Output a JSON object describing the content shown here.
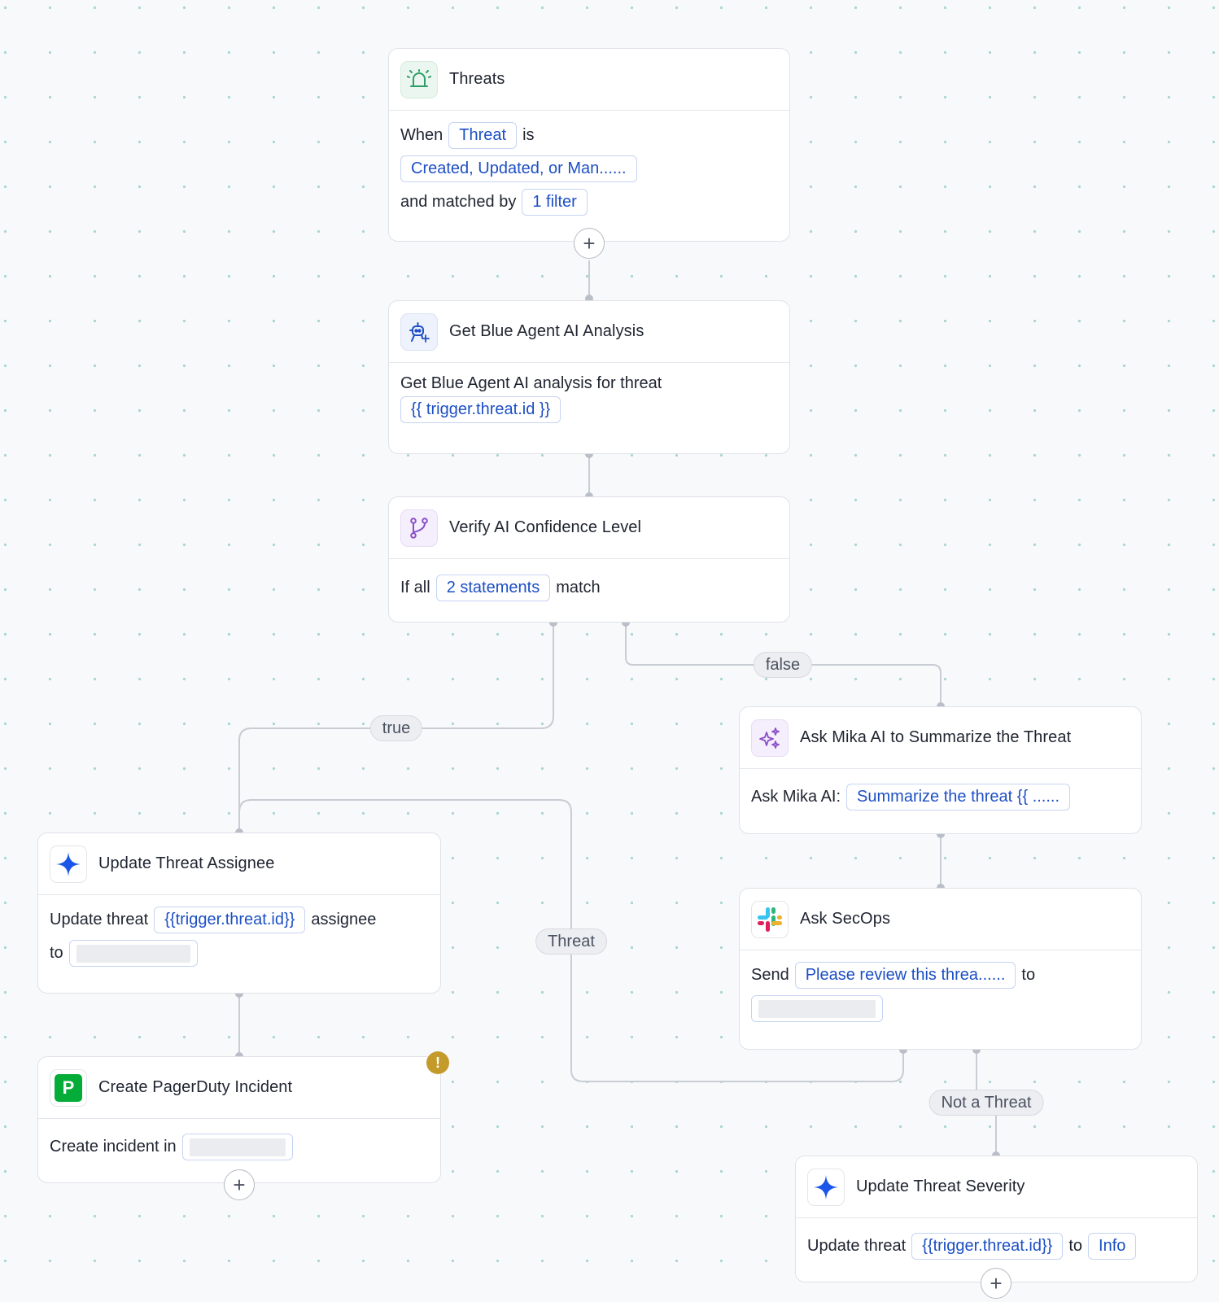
{
  "nodes": {
    "threats": {
      "title": "Threats",
      "when": "When",
      "threat_pill": "Threat",
      "is": "is",
      "events_pill": "Created, Updated, or Man......",
      "matched_by": "and matched by",
      "filter_pill": "1 filter"
    },
    "blue_agent": {
      "title": "Get Blue Agent AI Analysis",
      "desc": "Get Blue Agent AI analysis for threat",
      "threat_pill": "{{ trigger.threat.id }}"
    },
    "verify": {
      "title": "Verify AI Confidence Level",
      "if_all": "If all",
      "statements_pill": "2 statements",
      "match": "match"
    },
    "mika": {
      "title": "Ask Mika AI to Summarize the Threat",
      "label": "Ask Mika AI:",
      "prompt_pill": "Summarize the threat {{ ......"
    },
    "assignee": {
      "title": "Update Threat Assignee",
      "update_threat": "Update threat",
      "threat_pill": "{{trigger.threat.id}}",
      "assignee": "assignee",
      "to": "to"
    },
    "secops": {
      "title": "Ask SecOps",
      "send": "Send",
      "message_pill": "Please review this threa......",
      "to": "to"
    },
    "pagerduty": {
      "title": "Create PagerDuty Incident",
      "create_in": "Create incident in",
      "warning": "!"
    },
    "severity": {
      "title": "Update Threat Severity",
      "update_threat": "Update threat",
      "threat_pill": "{{trigger.threat.id}}",
      "to": "to",
      "severity_pill": "Info"
    }
  },
  "edge_labels": {
    "true": "true",
    "false": "false",
    "threat": "Threat",
    "not_threat": "Not a Threat"
  },
  "icons": {
    "threats": "siren-icon",
    "blue_agent": "ai-agent-icon",
    "verify": "branch-icon",
    "mika": "sparkles-icon",
    "assignee": "star-sparkle-icon",
    "secops": "slack-icon",
    "pagerduty": "pagerduty-icon",
    "severity": "star-sparkle-icon"
  },
  "plus_symbol": "+",
  "colors": {
    "accent_blue": "#1d4fc4",
    "siren_green": "#2f9e6a",
    "branch_purple": "#8a4fc8",
    "pagerduty_green": "#06ac38",
    "warning_gold": "#c49a2a"
  }
}
